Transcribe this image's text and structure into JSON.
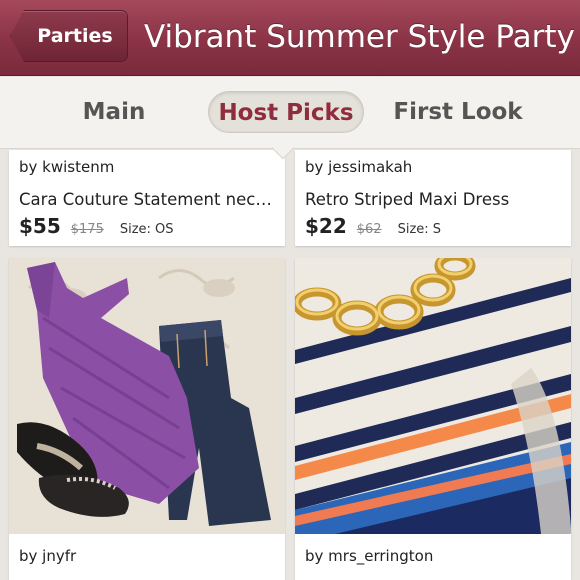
{
  "header": {
    "back_label": "Parties",
    "title": "Vibrant Summer Style Party"
  },
  "tabs": [
    {
      "label": "Main",
      "active": false
    },
    {
      "label": "Host Picks",
      "active": true
    },
    {
      "label": "First Look",
      "active": false
    }
  ],
  "listings": [
    {
      "seller": "by kwistenm",
      "title": "Cara Couture Statement neckl…",
      "price": "$55",
      "original_price": "$175",
      "size": "Size: OS"
    },
    {
      "seller": "by jessimakah",
      "title": "Retro Striped Maxi Dress",
      "price": "$22",
      "original_price": "$62",
      "size": "Size: S"
    },
    {
      "seller": "by jnyfr",
      "photo_icon": "purple-halter-top-outfit"
    },
    {
      "seller": "by mrs_errington",
      "photo_icon": "striped-top-gold-chain"
    }
  ],
  "colors": {
    "header_red": "#8b3346",
    "active_tab_text": "#8f2c3e"
  }
}
